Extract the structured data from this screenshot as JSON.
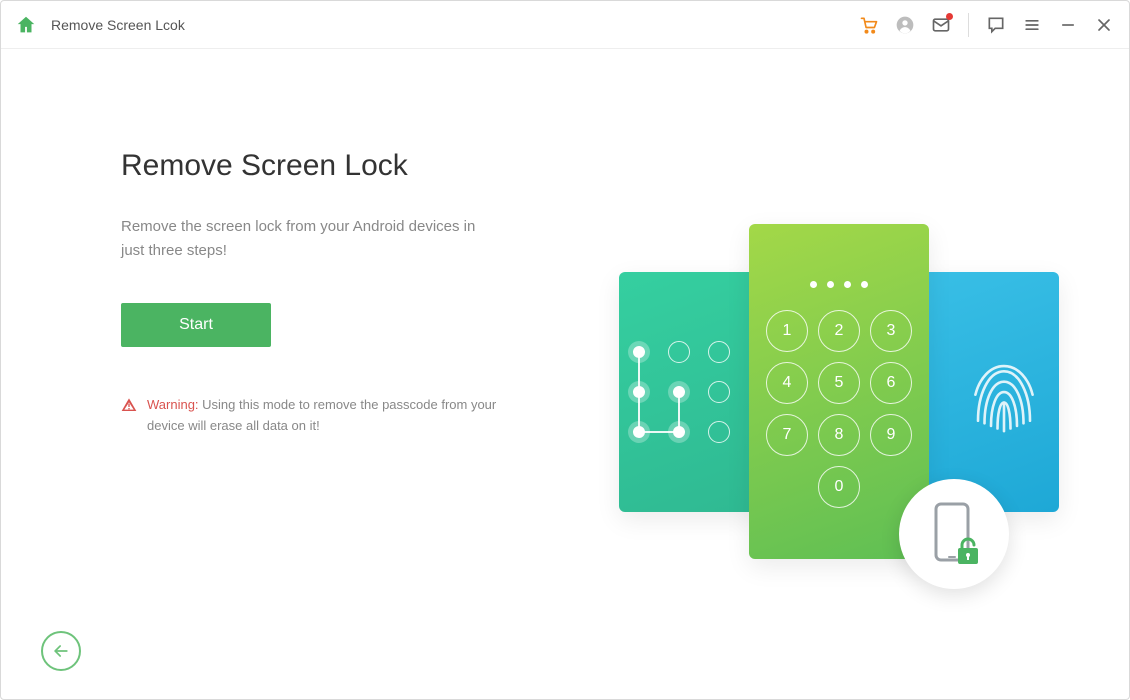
{
  "header": {
    "title": "Remove Screen Lcok"
  },
  "main": {
    "heading": "Remove Screen Lock",
    "description": "Remove the screen lock from your Android devices in just three steps!",
    "start_label": "Start",
    "warning_label": "Warning:",
    "warning_text": " Using this mode to remove the passcode from your device will erase all data on it!"
  },
  "illustration": {
    "keypad": [
      "1",
      "2",
      "3",
      "4",
      "5",
      "6",
      "7",
      "8",
      "9",
      "0"
    ]
  },
  "colors": {
    "accent_green": "#4bb462",
    "warn_red": "#d9534f",
    "cart_orange": "#f28a1a"
  }
}
